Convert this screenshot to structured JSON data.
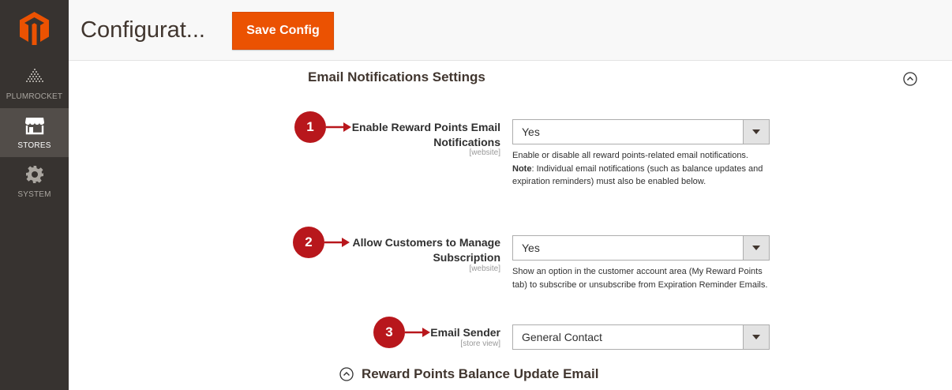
{
  "sidebar": {
    "items": [
      {
        "label": "PLUMROCKET",
        "icon": "plumrocket-icon"
      },
      {
        "label": "STORES",
        "icon": "store-icon",
        "active": true
      },
      {
        "label": "SYSTEM",
        "icon": "gear-icon"
      }
    ]
  },
  "header": {
    "title": "Configurat...",
    "save_label": "Save Config"
  },
  "section": {
    "title": "Email Notifications Settings"
  },
  "fields": [
    {
      "badge": "1",
      "label": "Enable Reward Points Email Notifications",
      "scope": "[website]",
      "value": "Yes",
      "note_line1": "Enable or disable all reward points-related email notifications.",
      "note_strong": "Note",
      "note_line2": ": Individual email notifications (such as balance updates and expiration reminders) must also be enabled below."
    },
    {
      "badge": "2",
      "label": "Allow Customers to Manage Subscription",
      "scope": "[website]",
      "value": "Yes",
      "note": "Show an option in the customer account area (My Reward Points tab) to subscribe or unsubscribe from Expiration Reminder Emails."
    },
    {
      "badge": "3",
      "label": "Email Sender",
      "scope": "[store view]",
      "value": "General Contact"
    }
  ],
  "subsection": {
    "title": "Reward Points Balance Update Email"
  },
  "colors": {
    "accent": "#eb5202",
    "badge": "#b8171c",
    "sidebar_bg": "#373330"
  }
}
